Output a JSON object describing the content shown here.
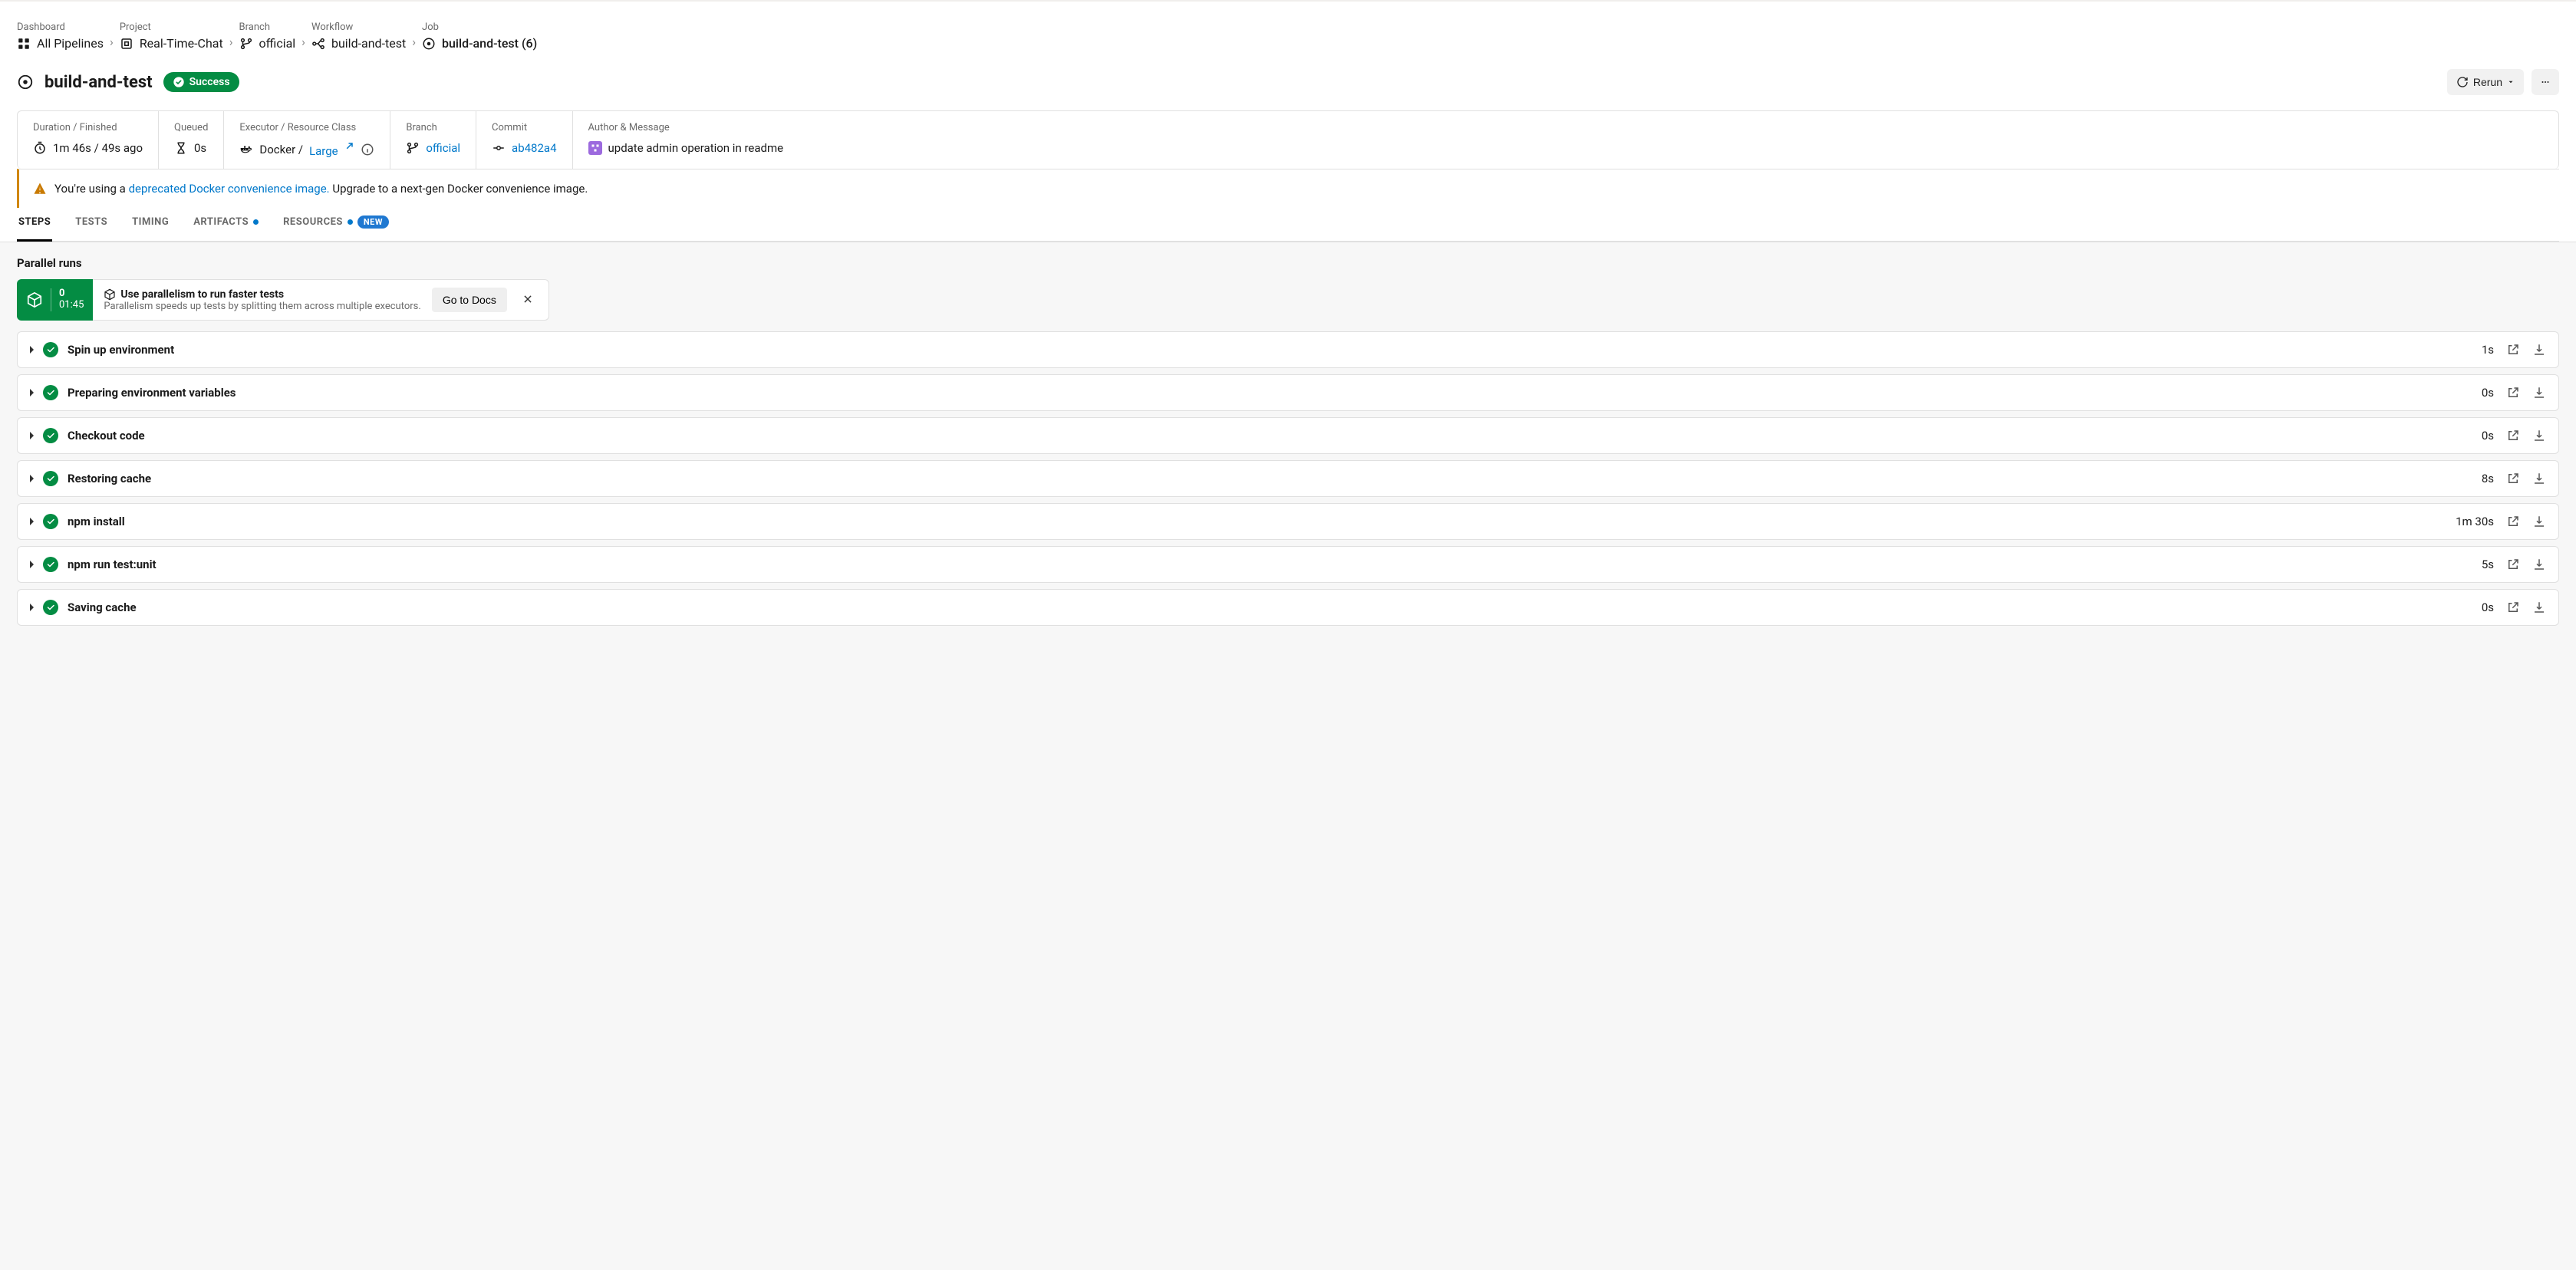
{
  "breadcrumb": {
    "items": [
      {
        "cat": "Dashboard",
        "name": "All Pipelines"
      },
      {
        "cat": "Project",
        "name": "Real-Time-Chat"
      },
      {
        "cat": "Branch",
        "name": "official"
      },
      {
        "cat": "Workflow",
        "name": "build-and-test"
      },
      {
        "cat": "Job",
        "name": "build-and-test (6)"
      }
    ]
  },
  "title": {
    "name": "build-and-test",
    "status": "Success",
    "rerun_label": "Rerun"
  },
  "meta": {
    "duration_label": "Duration / Finished",
    "duration_value": "1m 46s / 49s ago",
    "queued_label": "Queued",
    "queued_value": "0s",
    "executor_label": "Executor / Resource Class",
    "executor_value_prefix": "Docker / ",
    "executor_class": "Large",
    "branch_label": "Branch",
    "branch_value": "official",
    "commit_label": "Commit",
    "commit_value": "ab482a4",
    "author_label": "Author & Message",
    "author_message": "update admin operation in readme"
  },
  "warning": {
    "prefix": "You're using a ",
    "link_text": "deprecated Docker convenience image.",
    "suffix": " Upgrade to a next-gen Docker convenience image."
  },
  "tabs": {
    "steps": "STEPS",
    "tests": "TESTS",
    "timing": "TIMING",
    "artifacts": "ARTIFACTS",
    "resources": "RESOURCES",
    "new_badge": "NEW"
  },
  "parallel": {
    "section_title": "Parallel runs",
    "index": "0",
    "dur": "01:45",
    "tip_title": "Use parallelism to run faster tests",
    "tip_sub": "Parallelism speeds up tests by splitting them across multiple executors.",
    "docs_btn": "Go to Docs"
  },
  "steps": [
    {
      "name": "Spin up environment",
      "dur": "1s"
    },
    {
      "name": "Preparing environment variables",
      "dur": "0s"
    },
    {
      "name": "Checkout code",
      "dur": "0s"
    },
    {
      "name": "Restoring cache",
      "dur": "8s"
    },
    {
      "name": "npm install",
      "dur": "1m 30s"
    },
    {
      "name": "npm run test:unit",
      "dur": "5s"
    },
    {
      "name": "Saving cache",
      "dur": "0s"
    }
  ]
}
